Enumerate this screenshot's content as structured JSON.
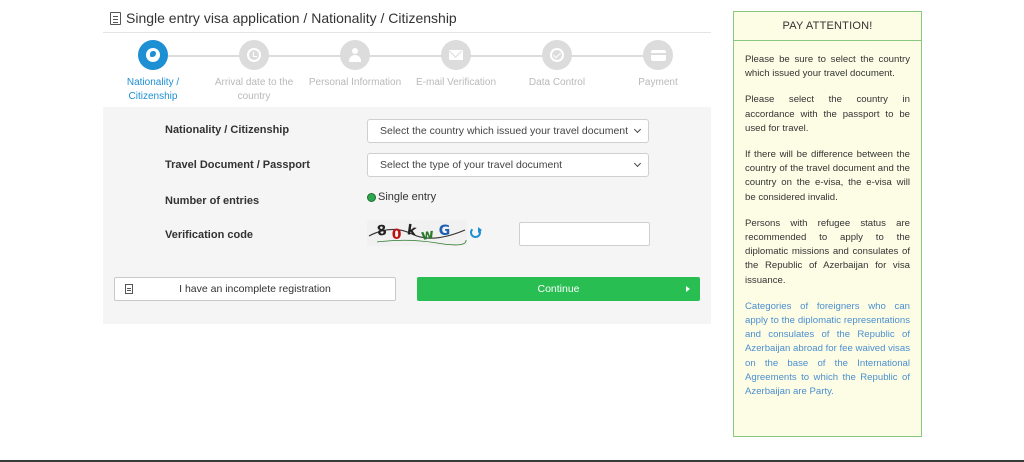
{
  "header": {
    "title": "Single entry visa application / Nationality / Citizenship"
  },
  "steps": [
    {
      "label": "Nationality / Citizenship",
      "icon": "globe-icon",
      "active": true
    },
    {
      "label": "Arrival date to the country",
      "icon": "clock-icon",
      "active": false
    },
    {
      "label": "Personal Information",
      "icon": "user-icon",
      "active": false
    },
    {
      "label": "E-mail Verification",
      "icon": "envelope-icon",
      "active": false
    },
    {
      "label": "Data Control",
      "icon": "check-circle-icon",
      "active": false
    },
    {
      "label": "Payment",
      "icon": "credit-card-icon",
      "active": false
    }
  ],
  "form": {
    "nationality_label": "Nationality / Citizenship",
    "nationality_value": "Select the country which issued your travel document",
    "document_label": "Travel Document / Passport",
    "document_value": "Select the type of your travel document",
    "entries_label": "Number of entries",
    "entries_value": "Single entry",
    "verification_label": "Verification code",
    "captcha_text": "8 0 k w G u"
  },
  "actions": {
    "incomplete_label": "I have an incomplete registration",
    "continue_label": "Continue"
  },
  "notice": {
    "title": "PAY ATTENTION!",
    "p1": "Please be sure to select the country which issued your travel document.",
    "p2": "Please select the country in accordance with the passport to be used for travel.",
    "p3": "If there will be difference between the country of the travel document and the country on the e-visa, the e-visa will be considered invalid.",
    "p4": "Persons with refugee status are recommended to apply to the diplomatic missions and consulates of the Republic of Azerbaijan for visa issuance.",
    "p5": "Categories of foreigners who can apply to the diplomatic representations and consulates of the Republic of Azerbaijan abroad for fee waived visas on the base of the International Agreements to which the Republic of Azerbaijan are Party."
  },
  "colors": {
    "accent": "#1d8fd3",
    "success": "#29be52",
    "notice_bg": "#fdfde6",
    "notice_border": "#87c87e",
    "link": "#4b8fcf"
  }
}
